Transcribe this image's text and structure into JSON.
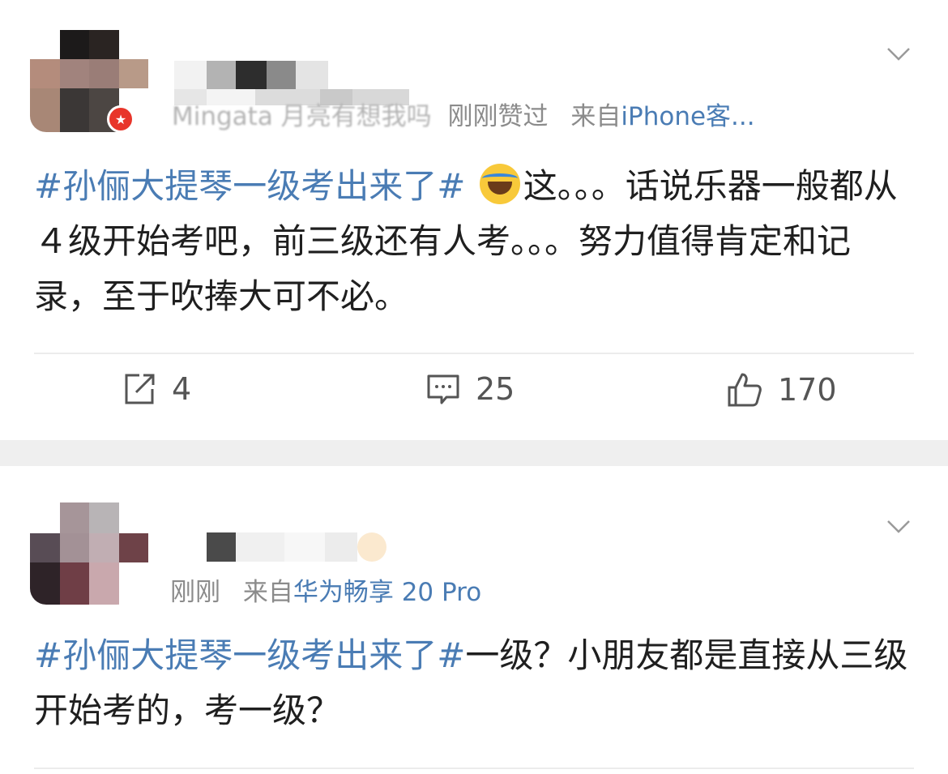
{
  "posts": [
    {
      "user_name_hint": "Mingata 月亮有想我吗",
      "liked_status": "刚刚赞过",
      "source_prefix": "来自",
      "source": "iPhone客...",
      "hashtag": "#孙俪大提琴一级考出来了#",
      "text": "这。。。话说乐器一般都从４级开始考吧，前三级还有人考。。。努力值得肯定和记录，至于吹捧大可不必。",
      "actions": {
        "repost_count": "4",
        "comment_count": "25",
        "like_count": "170"
      }
    },
    {
      "time": "刚刚",
      "source_prefix": "来自",
      "source": "华为畅享 20 Pro",
      "hashtag": "#孙俪大提琴一级考出来了#",
      "text": "一级？小朋友都是直接从三级开始考的，考一级？"
    }
  ],
  "icons": {
    "verified_badge": "star-badge-icon",
    "menu": "chevron-down-icon",
    "repost": "repost-icon",
    "comment": "comment-icon",
    "like": "thumbs-up-icon",
    "emoji": "laugh-cry-emoji-icon"
  },
  "colors": {
    "link_blue": "#4a7cb4",
    "meta_gray": "#8b8b8b",
    "badge_red": "#e8352a",
    "separator": "#efefef"
  }
}
